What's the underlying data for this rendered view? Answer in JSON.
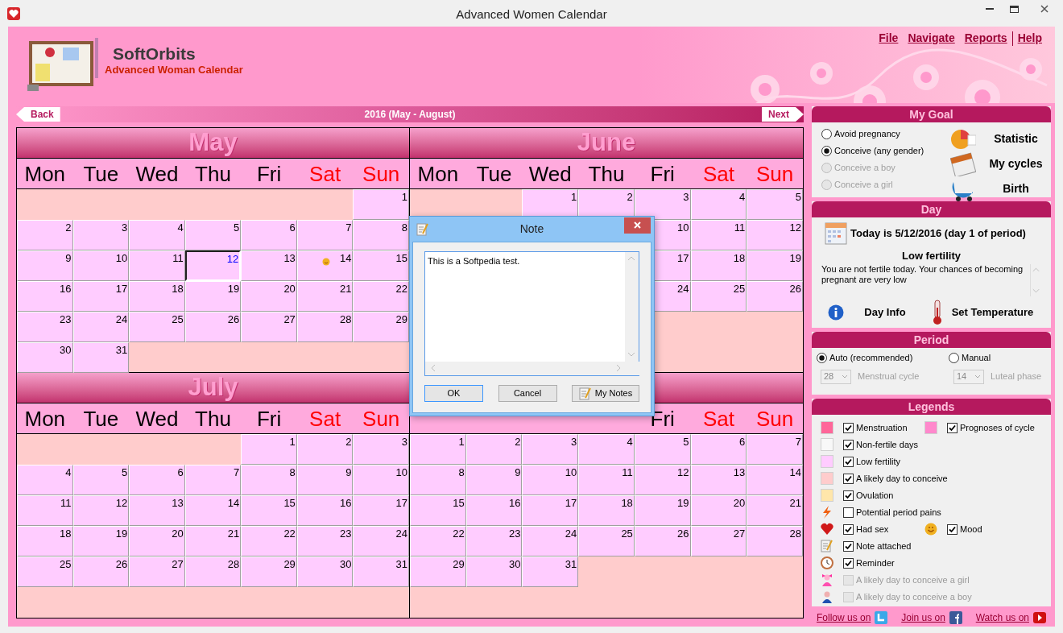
{
  "window": {
    "title": "Advanced Women Calendar"
  },
  "menu": [
    "File",
    "Navigate",
    "Reports",
    "Help"
  ],
  "brand": {
    "name": "SoftOrbits",
    "product": "Advanced Woman Calendar"
  },
  "nav": {
    "back": "Back",
    "title": "2016 (May - August)",
    "next": "Next"
  },
  "months": [
    {
      "title": "May",
      "weekdays": [
        {
          "label": "Mon",
          "weekend": false
        },
        {
          "label": "Tue",
          "weekend": false
        },
        {
          "label": "Wed",
          "weekend": false
        },
        {
          "label": "Thu",
          "weekend": false
        },
        {
          "label": "Fri",
          "weekend": false
        },
        {
          "label": "Sat",
          "weekend": true
        },
        {
          "label": "Sun",
          "weekend": true
        }
      ],
      "weeks": [
        [
          {
            "kind": "empty"
          },
          {
            "kind": "empty"
          },
          {
            "kind": "empty"
          },
          {
            "kind": "empty"
          },
          {
            "kind": "empty"
          },
          {
            "kind": "empty"
          },
          {
            "kind": "day",
            "day": "1",
            "today": false,
            "mood": false
          }
        ],
        [
          {
            "kind": "day",
            "day": "2",
            "today": false,
            "mood": false
          },
          {
            "kind": "day",
            "day": "3",
            "today": false,
            "mood": false
          },
          {
            "kind": "day",
            "day": "4",
            "today": false,
            "mood": false
          },
          {
            "kind": "day",
            "day": "5",
            "today": false,
            "mood": false
          },
          {
            "kind": "day",
            "day": "6",
            "today": false,
            "mood": false
          },
          {
            "kind": "day",
            "day": "7",
            "today": false,
            "mood": false
          },
          {
            "kind": "day",
            "day": "8",
            "today": false,
            "mood": false
          }
        ],
        [
          {
            "kind": "day",
            "day": "9",
            "today": false,
            "mood": false
          },
          {
            "kind": "day",
            "day": "10",
            "today": false,
            "mood": false
          },
          {
            "kind": "day",
            "day": "11",
            "today": false,
            "mood": false
          },
          {
            "kind": "day",
            "day": "12",
            "today": true,
            "mood": false
          },
          {
            "kind": "day",
            "day": "13",
            "today": false,
            "mood": false
          },
          {
            "kind": "day",
            "day": "14",
            "today": false,
            "mood": true
          },
          {
            "kind": "day",
            "day": "15",
            "today": false,
            "mood": false
          }
        ],
        [
          {
            "kind": "day",
            "day": "16",
            "today": false,
            "mood": false
          },
          {
            "kind": "day",
            "day": "17",
            "today": false,
            "mood": false
          },
          {
            "kind": "day",
            "day": "18",
            "today": false,
            "mood": false
          },
          {
            "kind": "day",
            "day": "19",
            "today": false,
            "mood": false
          },
          {
            "kind": "day",
            "day": "20",
            "today": false,
            "mood": false
          },
          {
            "kind": "day",
            "day": "21",
            "today": false,
            "mood": false
          },
          {
            "kind": "day",
            "day": "22",
            "today": false,
            "mood": false
          }
        ],
        [
          {
            "kind": "day",
            "day": "23",
            "today": false,
            "mood": false
          },
          {
            "kind": "day",
            "day": "24",
            "today": false,
            "mood": false
          },
          {
            "kind": "day",
            "day": "25",
            "today": false,
            "mood": false
          },
          {
            "kind": "day",
            "day": "26",
            "today": false,
            "mood": false
          },
          {
            "kind": "day",
            "day": "27",
            "today": false,
            "mood": false
          },
          {
            "kind": "day",
            "day": "28",
            "today": false,
            "mood": false
          },
          {
            "kind": "day",
            "day": "29",
            "today": false,
            "mood": false
          }
        ],
        [
          {
            "kind": "day",
            "day": "30",
            "today": false,
            "mood": false
          },
          {
            "kind": "day",
            "day": "31",
            "today": false,
            "mood": false
          },
          {
            "kind": "empty"
          },
          {
            "kind": "empty"
          },
          {
            "kind": "empty"
          },
          {
            "kind": "empty"
          },
          {
            "kind": "empty"
          }
        ]
      ]
    },
    {
      "title": "June",
      "weekdays": [
        {
          "label": "Mon",
          "weekend": false
        },
        {
          "label": "Tue",
          "weekend": false
        },
        {
          "label": "Wed",
          "weekend": false
        },
        {
          "label": "Thu",
          "weekend": false
        },
        {
          "label": "Fri",
          "weekend": false
        },
        {
          "label": "Sat",
          "weekend": true
        },
        {
          "label": "Sun",
          "weekend": true
        }
      ],
      "weeks": [
        [
          {
            "kind": "empty"
          },
          {
            "kind": "empty"
          },
          {
            "kind": "day",
            "day": "1",
            "today": false,
            "mood": false
          },
          {
            "kind": "day",
            "day": "2",
            "today": false,
            "mood": false
          },
          {
            "kind": "day",
            "day": "3",
            "today": false,
            "mood": false
          },
          {
            "kind": "day",
            "day": "4",
            "today": false,
            "mood": false
          },
          {
            "kind": "day",
            "day": "5",
            "today": false,
            "mood": false
          }
        ],
        [
          {
            "kind": "covered"
          },
          {
            "kind": "covered"
          },
          {
            "kind": "covered"
          },
          {
            "kind": "covered"
          },
          {
            "kind": "day",
            "day": "10",
            "today": false,
            "mood": false
          },
          {
            "kind": "day",
            "day": "11",
            "today": false,
            "mood": false
          },
          {
            "kind": "day",
            "day": "12",
            "today": false,
            "mood": false
          }
        ],
        [
          {
            "kind": "covered"
          },
          {
            "kind": "covered"
          },
          {
            "kind": "covered"
          },
          {
            "kind": "covered"
          },
          {
            "kind": "day",
            "day": "17",
            "today": false,
            "mood": false
          },
          {
            "kind": "day",
            "day": "18",
            "today": false,
            "mood": false
          },
          {
            "kind": "day",
            "day": "19",
            "today": false,
            "mood": false
          }
        ],
        [
          {
            "kind": "covered"
          },
          {
            "kind": "covered"
          },
          {
            "kind": "covered"
          },
          {
            "kind": "covered"
          },
          {
            "kind": "day",
            "day": "24",
            "today": false,
            "mood": false
          },
          {
            "kind": "day",
            "day": "25",
            "today": false,
            "mood": false
          },
          {
            "kind": "day",
            "day": "26",
            "today": false,
            "mood": false
          }
        ],
        [
          {
            "kind": "covered"
          },
          {
            "kind": "covered"
          },
          {
            "kind": "covered"
          },
          {
            "kind": "covered"
          },
          {
            "kind": "empty"
          },
          {
            "kind": "empty"
          },
          {
            "kind": "empty"
          }
        ]
      ]
    },
    {
      "title": "July",
      "weekdays": [
        {
          "label": "Mon",
          "weekend": false
        },
        {
          "label": "Tue",
          "weekend": false
        },
        {
          "label": "Wed",
          "weekend": false
        },
        {
          "label": "Thu",
          "weekend": false
        },
        {
          "label": "Fri",
          "weekend": false
        },
        {
          "label": "Sat",
          "weekend": true
        },
        {
          "label": "Sun",
          "weekend": true
        }
      ],
      "weeks": [
        [
          {
            "kind": "empty"
          },
          {
            "kind": "empty"
          },
          {
            "kind": "empty"
          },
          {
            "kind": "empty"
          },
          {
            "kind": "day",
            "day": "1",
            "today": false,
            "mood": false
          },
          {
            "kind": "day",
            "day": "2",
            "today": false,
            "mood": false
          },
          {
            "kind": "day",
            "day": "3",
            "today": false,
            "mood": false
          }
        ],
        [
          {
            "kind": "day",
            "day": "4",
            "today": false,
            "mood": false
          },
          {
            "kind": "day",
            "day": "5",
            "today": false,
            "mood": false
          },
          {
            "kind": "day",
            "day": "6",
            "today": false,
            "mood": false
          },
          {
            "kind": "day",
            "day": "7",
            "today": false,
            "mood": false
          },
          {
            "kind": "day",
            "day": "8",
            "today": false,
            "mood": false
          },
          {
            "kind": "day",
            "day": "9",
            "today": false,
            "mood": false
          },
          {
            "kind": "day",
            "day": "10",
            "today": false,
            "mood": false
          }
        ],
        [
          {
            "kind": "day",
            "day": "11",
            "today": false,
            "mood": false
          },
          {
            "kind": "day",
            "day": "12",
            "today": false,
            "mood": false
          },
          {
            "kind": "day",
            "day": "13",
            "today": false,
            "mood": false
          },
          {
            "kind": "day",
            "day": "14",
            "today": false,
            "mood": false
          },
          {
            "kind": "day",
            "day": "15",
            "today": false,
            "mood": false
          },
          {
            "kind": "day",
            "day": "16",
            "today": false,
            "mood": false
          },
          {
            "kind": "day",
            "day": "17",
            "today": false,
            "mood": false
          }
        ],
        [
          {
            "kind": "day",
            "day": "18",
            "today": false,
            "mood": false
          },
          {
            "kind": "day",
            "day": "19",
            "today": false,
            "mood": false
          },
          {
            "kind": "day",
            "day": "20",
            "today": false,
            "mood": false
          },
          {
            "kind": "day",
            "day": "21",
            "today": false,
            "mood": false
          },
          {
            "kind": "day",
            "day": "22",
            "today": false,
            "mood": false
          },
          {
            "kind": "day",
            "day": "23",
            "today": false,
            "mood": false
          },
          {
            "kind": "day",
            "day": "24",
            "today": false,
            "mood": false
          }
        ],
        [
          {
            "kind": "day",
            "day": "25",
            "today": false,
            "mood": false
          },
          {
            "kind": "day",
            "day": "26",
            "today": false,
            "mood": false
          },
          {
            "kind": "day",
            "day": "27",
            "today": false,
            "mood": false
          },
          {
            "kind": "day",
            "day": "28",
            "today": false,
            "mood": false
          },
          {
            "kind": "day",
            "day": "29",
            "today": false,
            "mood": false
          },
          {
            "kind": "day",
            "day": "30",
            "today": false,
            "mood": false
          },
          {
            "kind": "day",
            "day": "31",
            "today": false,
            "mood": false
          }
        ]
      ]
    },
    {
      "weekdays": [
        {
          "label": "Fri",
          "weekend": false
        },
        {
          "label": "Sat",
          "weekend": true
        },
        {
          "label": "Sun",
          "weekend": true
        }
      ],
      "weeks": [
        [
          {
            "kind": "day",
            "day": "1",
            "today": false,
            "mood": false
          },
          {
            "kind": "day",
            "day": "2",
            "today": false,
            "mood": false
          },
          {
            "kind": "day",
            "day": "3",
            "today": false,
            "mood": false
          },
          {
            "kind": "day",
            "day": "4",
            "today": false,
            "mood": false
          },
          {
            "kind": "day",
            "day": "5",
            "today": false,
            "mood": false
          },
          {
            "kind": "day",
            "day": "6",
            "today": false,
            "mood": false
          },
          {
            "kind": "day",
            "day": "7",
            "today": false,
            "mood": false
          }
        ],
        [
          {
            "kind": "day",
            "day": "8",
            "today": false,
            "mood": false
          },
          {
            "kind": "day",
            "day": "9",
            "today": false,
            "mood": false
          },
          {
            "kind": "day",
            "day": "10",
            "today": false,
            "mood": false
          },
          {
            "kind": "day",
            "day": "11",
            "today": false,
            "mood": false
          },
          {
            "kind": "day",
            "day": "12",
            "today": false,
            "mood": false
          },
          {
            "kind": "day",
            "day": "13",
            "today": false,
            "mood": false
          },
          {
            "kind": "day",
            "day": "14",
            "today": false,
            "mood": false
          }
        ],
        [
          {
            "kind": "day",
            "day": "15",
            "today": false,
            "mood": false
          },
          {
            "kind": "day",
            "day": "16",
            "today": false,
            "mood": false
          },
          {
            "kind": "day",
            "day": "17",
            "today": false,
            "mood": false
          },
          {
            "kind": "day",
            "day": "18",
            "today": false,
            "mood": false
          },
          {
            "kind": "day",
            "day": "19",
            "today": false,
            "mood": false
          },
          {
            "kind": "day",
            "day": "20",
            "today": false,
            "mood": false
          },
          {
            "kind": "day",
            "day": "21",
            "today": false,
            "mood": false
          }
        ],
        [
          {
            "kind": "day",
            "day": "22",
            "today": false,
            "mood": false
          },
          {
            "kind": "day",
            "day": "23",
            "today": false,
            "mood": false
          },
          {
            "kind": "day",
            "day": "24",
            "today": false,
            "mood": false
          },
          {
            "kind": "day",
            "day": "25",
            "today": false,
            "mood": false
          },
          {
            "kind": "day",
            "day": "26",
            "today": false,
            "mood": false
          },
          {
            "kind": "day",
            "day": "27",
            "today": false,
            "mood": false
          },
          {
            "kind": "day",
            "day": "28",
            "today": false,
            "mood": false
          }
        ],
        [
          {
            "kind": "day",
            "day": "29",
            "today": false,
            "mood": false
          },
          {
            "kind": "day",
            "day": "30",
            "today": false,
            "mood": false
          },
          {
            "kind": "day",
            "day": "31",
            "today": false,
            "mood": false
          },
          {
            "kind": "empty"
          },
          {
            "kind": "empty"
          },
          {
            "kind": "empty"
          },
          {
            "kind": "empty"
          }
        ]
      ]
    }
  ],
  "goal": {
    "title": "My Goal",
    "options": [
      {
        "label": "Avoid pregnancy",
        "selected": false,
        "disabled": false
      },
      {
        "label": "Conceive (any gender)",
        "selected": true,
        "disabled": false
      },
      {
        "label": "Conceive a boy",
        "selected": false,
        "disabled": true
      },
      {
        "label": "Conceive a girl",
        "selected": false,
        "disabled": true
      }
    ],
    "actions": [
      "Statistic",
      "My cycles",
      "Birth"
    ]
  },
  "day": {
    "title": "Day",
    "today": "Today is 5/12/2016 (day 1 of period)",
    "fertility": "Low fertility",
    "description": "You are not fertile today. Your chances of becoming pregnant are very low",
    "actions": [
      "Day Info",
      "Set Temperature"
    ]
  },
  "period": {
    "title": "Period",
    "modes": [
      {
        "label": "Auto (recommended)",
        "selected": true
      },
      {
        "label": "Manual",
        "selected": false
      }
    ],
    "fields": [
      {
        "value": "28",
        "label": "Menstrual cycle",
        "disabled": true
      },
      {
        "value": "14",
        "label": "Luteal phase",
        "disabled": true
      }
    ]
  },
  "legends": {
    "title": "Legends",
    "rows": [
      [
        {
          "kind": "swatch",
          "color": "#ff6699",
          "label": "Menstruation",
          "checked": true,
          "disabled": false
        },
        {
          "kind": "swatch",
          "color": "#ff88cc",
          "label": "Prognoses of cycle",
          "checked": true,
          "disabled": false
        }
      ],
      [
        {
          "kind": "swatch",
          "color": "#f8f8f8",
          "label": "Non-fertile days",
          "checked": true,
          "disabled": false
        }
      ],
      [
        {
          "kind": "swatch",
          "color": "#ffccff",
          "label": "Low fertility",
          "checked": true,
          "disabled": false
        }
      ],
      [
        {
          "kind": "swatch",
          "color": "#ffcccc",
          "label": "A likely day to conceive",
          "checked": true,
          "disabled": false
        }
      ],
      [
        {
          "kind": "swatch",
          "color": "#ffe6aa",
          "label": "Ovulation",
          "checked": true,
          "disabled": false
        }
      ],
      [
        {
          "kind": "icon",
          "label": "Potential period pains",
          "checked": false,
          "disabled": false
        }
      ],
      [
        {
          "kind": "icon",
          "label": "Had sex",
          "checked": true,
          "disabled": false
        },
        {
          "kind": "icon",
          "label": "Mood",
          "checked": true,
          "disabled": false
        }
      ],
      [
        {
          "kind": "icon",
          "label": "Note attached",
          "checked": true,
          "disabled": false
        }
      ],
      [
        {
          "kind": "icon",
          "label": "Reminder",
          "checked": true,
          "disabled": false
        }
      ],
      [
        {
          "kind": "icon",
          "label": "A likely day to conceive a girl",
          "checked": false,
          "disabled": true
        }
      ],
      [
        {
          "kind": "icon",
          "label": "A likely day to conceive a boy",
          "checked": false,
          "disabled": true
        }
      ]
    ]
  },
  "footer": [
    "Follow us on",
    "Join us on",
    "Watch us on"
  ],
  "dialog": {
    "title": "Note",
    "text": "This is a Softpedia test.",
    "buttons": [
      {
        "label": "OK",
        "default": true
      },
      {
        "label": "Cancel",
        "default": false
      },
      {
        "label": "My Notes",
        "default": false
      }
    ]
  }
}
